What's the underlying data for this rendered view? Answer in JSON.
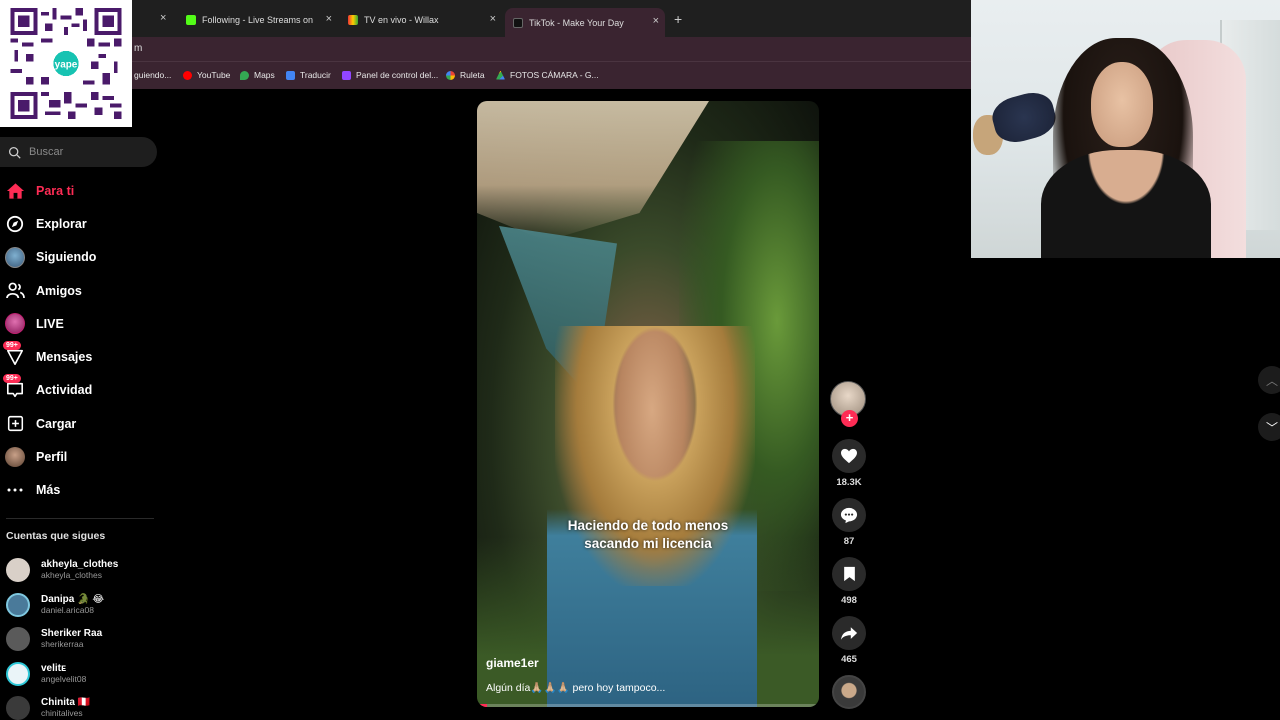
{
  "browser": {
    "tabs": [
      {
        "title": "",
        "close": "×"
      },
      {
        "title": "Following - Live Streams on Kic",
        "close": "×"
      },
      {
        "title": "TV en vivo - Willax",
        "close": "×"
      },
      {
        "title": "TikTok - Make Your Day",
        "close": "×"
      }
    ],
    "new_tab": "+",
    "url_fragment": "m",
    "bookmarks": [
      {
        "label": "guiendo...",
        "color": "#e0e0e0"
      },
      {
        "label": "YouTube",
        "color": "#ff0000"
      },
      {
        "label": "Maps",
        "color": "#34a853"
      },
      {
        "label": "Traducir",
        "color": "#4285f4"
      },
      {
        "label": "Panel de control del...",
        "color": "#9146ff"
      },
      {
        "label": "Ruleta",
        "color": "#ea4335"
      },
      {
        "label": "FOTOS CÁMARA - G...",
        "color": "#fbbc04"
      }
    ]
  },
  "sidebar": {
    "search_placeholder": "Buscar",
    "nav": [
      {
        "label": "Para ti",
        "icon": "home-icon",
        "active": true
      },
      {
        "label": "Explorar",
        "icon": "compass-icon"
      },
      {
        "label": "Siguiendo",
        "icon": "following-avatar-icon"
      },
      {
        "label": "Amigos",
        "icon": "friends-icon"
      },
      {
        "label": "LIVE",
        "icon": "live-icon"
      },
      {
        "label": "Mensajes",
        "icon": "messages-icon",
        "badge": "99+"
      },
      {
        "label": "Actividad",
        "icon": "activity-icon",
        "badge": "99+"
      },
      {
        "label": "Cargar",
        "icon": "upload-icon"
      },
      {
        "label": "Perfil",
        "icon": "profile-avatar-icon"
      },
      {
        "label": "Más",
        "icon": "more-icon"
      }
    ],
    "following_title": "Cuentas que sigues",
    "accounts": [
      {
        "name": "akheyla_clothes",
        "handle": "akheyla_clothes",
        "color": "#d9d0c8"
      },
      {
        "name": "Danipa 🐊 😂",
        "handle": "daniel.arica08",
        "color": "#4a7a9a"
      },
      {
        "name": "Sheriker Raa",
        "handle": "sherikerraa",
        "color": "#5a5a5a"
      },
      {
        "name": "velitᴇ",
        "handle": "angelvelit08",
        "color": "#6ab0c8"
      },
      {
        "name": "Chinita 🇵🇪",
        "handle": "chinitalives",
        "color": "#3a3a3a"
      }
    ]
  },
  "video": {
    "caption_line1": "Haciendo de todo menos",
    "caption_line2": "sacando mi licencia",
    "username": "giame1er",
    "description": "Algún día🙏🏼🙏🏼🙏🏼 pero hoy tampoco...",
    "progress_fraction": 0.03
  },
  "actions": {
    "follow_symbol": "+",
    "likes": "18.3K",
    "comments": "87",
    "saves": "498",
    "shares": "465"
  },
  "overlay": {
    "qr_brand": "yape",
    "scroll_up": "︿",
    "scroll_down": "﹀"
  },
  "colors": {
    "accent": "#fe2c55",
    "chrome": "#3a2430"
  }
}
